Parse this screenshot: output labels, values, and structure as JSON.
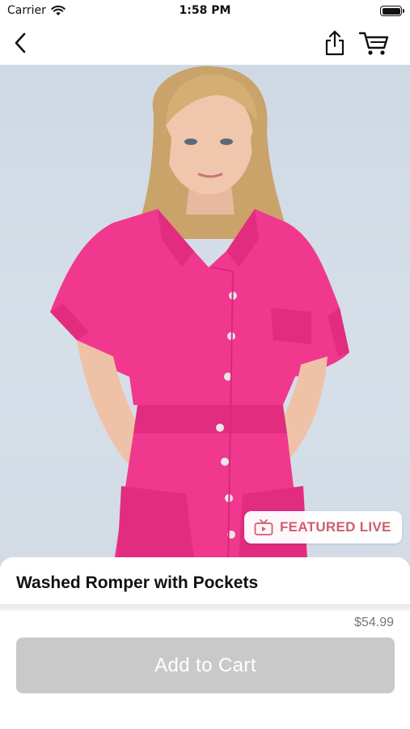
{
  "status_bar": {
    "carrier": "Carrier",
    "time": "1:58 PM",
    "icons": [
      "wifi-icon",
      "battery-icon"
    ]
  },
  "nav": {
    "icons": [
      "back-chevron-icon",
      "share-icon",
      "cart-icon"
    ]
  },
  "product": {
    "image_description_icon": "product-photo",
    "badge_label": "FEATURED LIVE",
    "title": "Washed Romper with Pockets",
    "price": "$54.99",
    "add_to_cart_label": "Add to Cart"
  },
  "colors": {
    "badge_accent": "#cf5f6b",
    "romper_pink": "#f0388f",
    "button_disabled": "#c9c9c9",
    "price_gray": "#777777"
  }
}
